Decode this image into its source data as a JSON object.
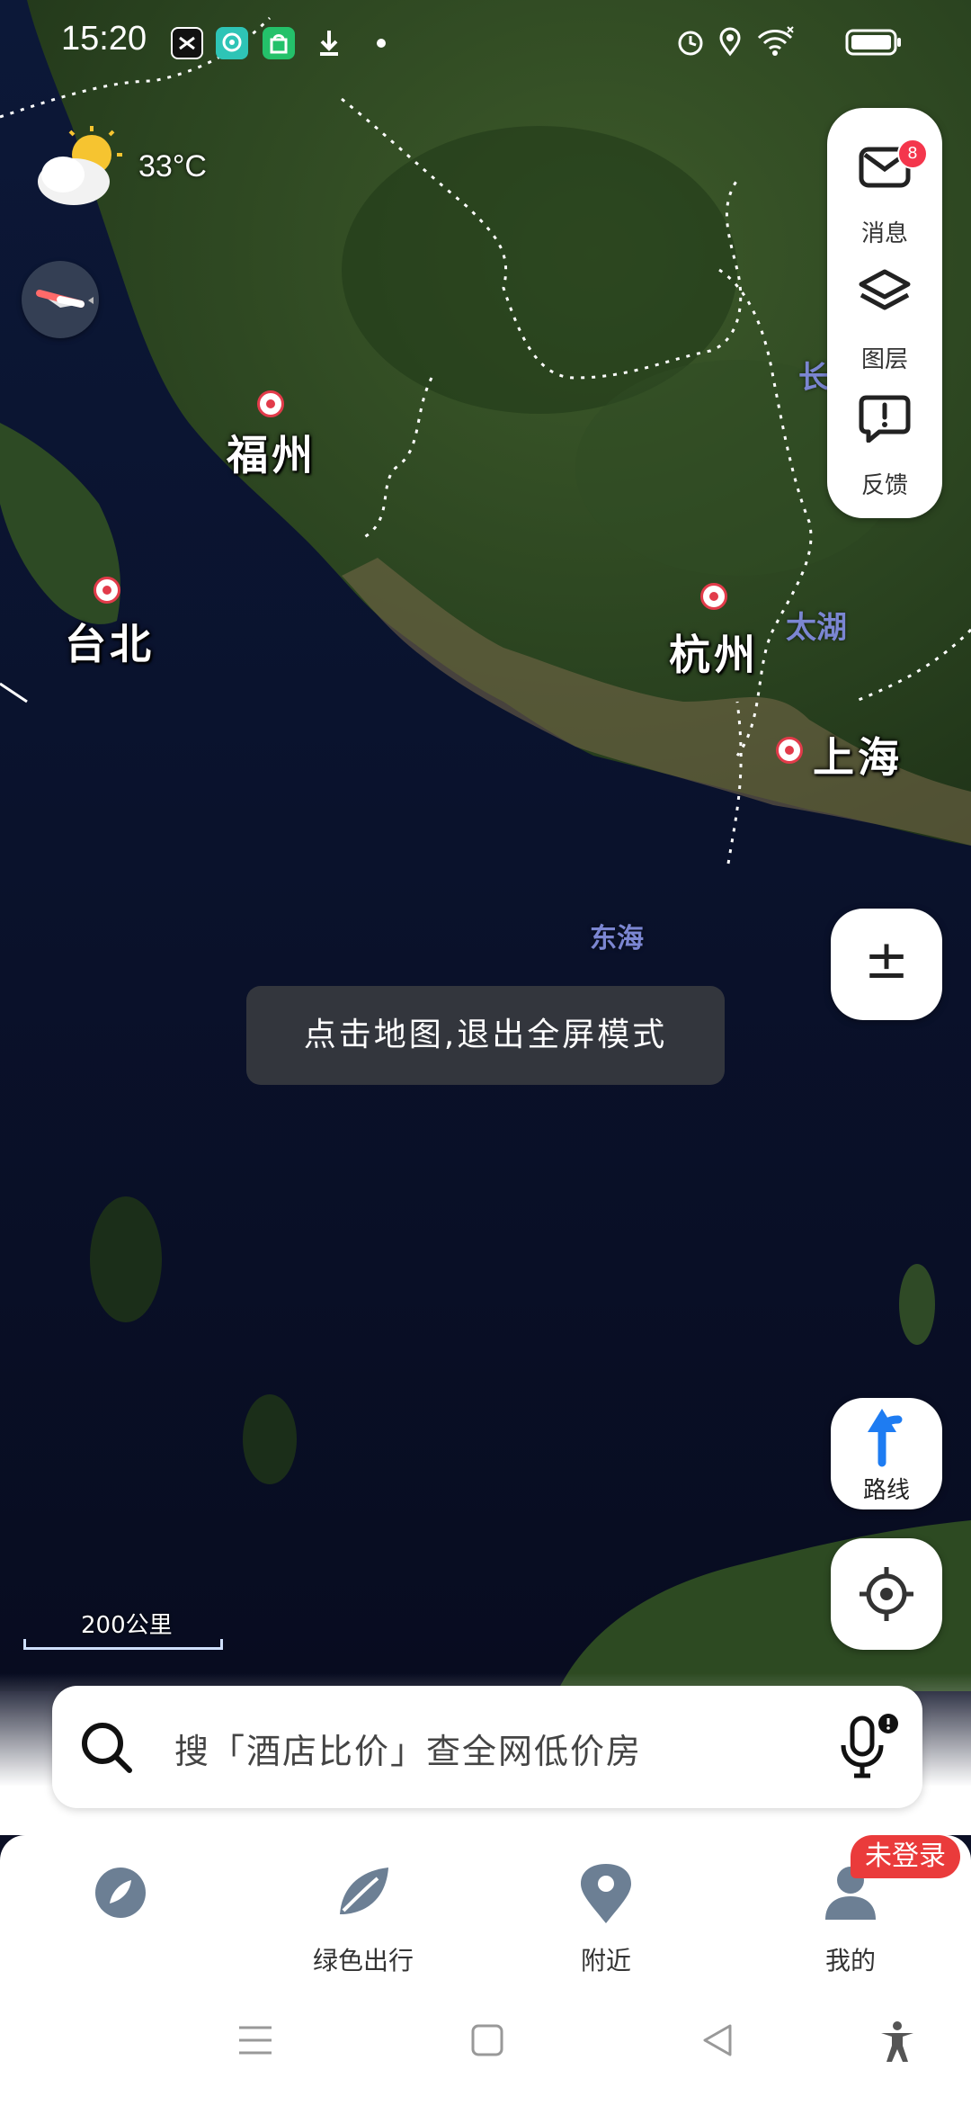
{
  "status_bar": {
    "time": "15:20",
    "app_icons": [
      "capcut-icon",
      "chat-bubble-icon",
      "shopping-bag-icon",
      "download-icon",
      "dot-icon"
    ],
    "right_icons": [
      "alarm-icon",
      "location-icon",
      "wifi-icon",
      "battery-icon"
    ]
  },
  "weather": {
    "temperature": "33°C",
    "icon": "partly-cloudy-icon"
  },
  "side_panel": {
    "messages_label": "消息",
    "messages_badge": "8",
    "layers_label": "图层",
    "feedback_label": "反馈"
  },
  "map": {
    "cities": [
      {
        "name": "福州"
      },
      {
        "name": "台北"
      },
      {
        "name": "杭州"
      },
      {
        "name": "上海"
      }
    ],
    "water_labels": [
      "太湖",
      "东海",
      "长"
    ],
    "scale": "200公里"
  },
  "zoom_button_label": "±",
  "route_button_label": "路线",
  "toast": "点击地图,退出全屏模式",
  "search": {
    "placeholder": "搜「酒店比价」查全网低价房"
  },
  "bottom_nav": {
    "items": [
      {
        "label": "",
        "icon": "discover-icon"
      },
      {
        "label": "绿色出行",
        "icon": "leaf-icon"
      },
      {
        "label": "附近",
        "icon": "nearby-pin-icon"
      },
      {
        "label": "我的",
        "icon": "profile-icon"
      }
    ],
    "login_badge": "未登录"
  },
  "colors": {
    "accent_red": "#e23b4a",
    "route_blue": "#1e7cf2",
    "water_label": "#7b86d2"
  }
}
